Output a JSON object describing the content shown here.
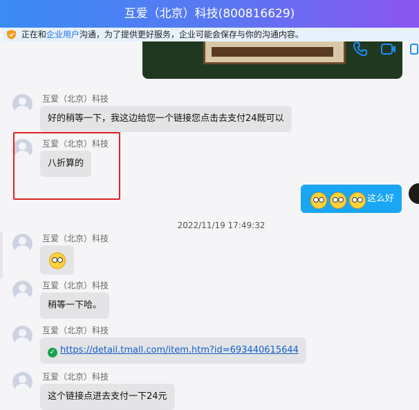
{
  "window": {
    "title": "互爱（北京）科技(800816629)"
  },
  "notice": {
    "prefix": "正在和",
    "link": "企业用户",
    "suffix": "沟通，为了提供更好服务，企业可能会保存与你的沟通内容。"
  },
  "messages": [
    {
      "sender": "互爱（北京）科技",
      "text": "好的稍等一下，我这边给您一个链接您点击去支付24既可以"
    },
    {
      "sender": "互爱（北京）科技",
      "text": "八折算的"
    },
    {
      "sender": "互爱（北京）科技",
      "text": ""
    },
    {
      "sender": "互爱（北京）科技",
      "text": "稍等一下哈。"
    },
    {
      "sender": "互爱（北京）科技",
      "link": "https://detail.tmall.com/item.htm?id=693440615644"
    },
    {
      "sender": "互爱（北京）科技",
      "text": "这个链接点进去支付一下24元"
    }
  ],
  "self_message": {
    "text": "这么好"
  },
  "timestamp": "2022/11/19 17:49:32",
  "colors": {
    "accent": "#1aa6f3",
    "title_gradient_start": "#3a8cf5",
    "title_gradient_end": "#8b55f0",
    "highlight": "#e02020"
  },
  "icons": {
    "notice": "shield-icon",
    "top_right": [
      "phone-icon",
      "video-call-icon",
      "more-icon"
    ],
    "link_status": "verified-check-icon",
    "reaction": "surprised-emoji-icon"
  }
}
